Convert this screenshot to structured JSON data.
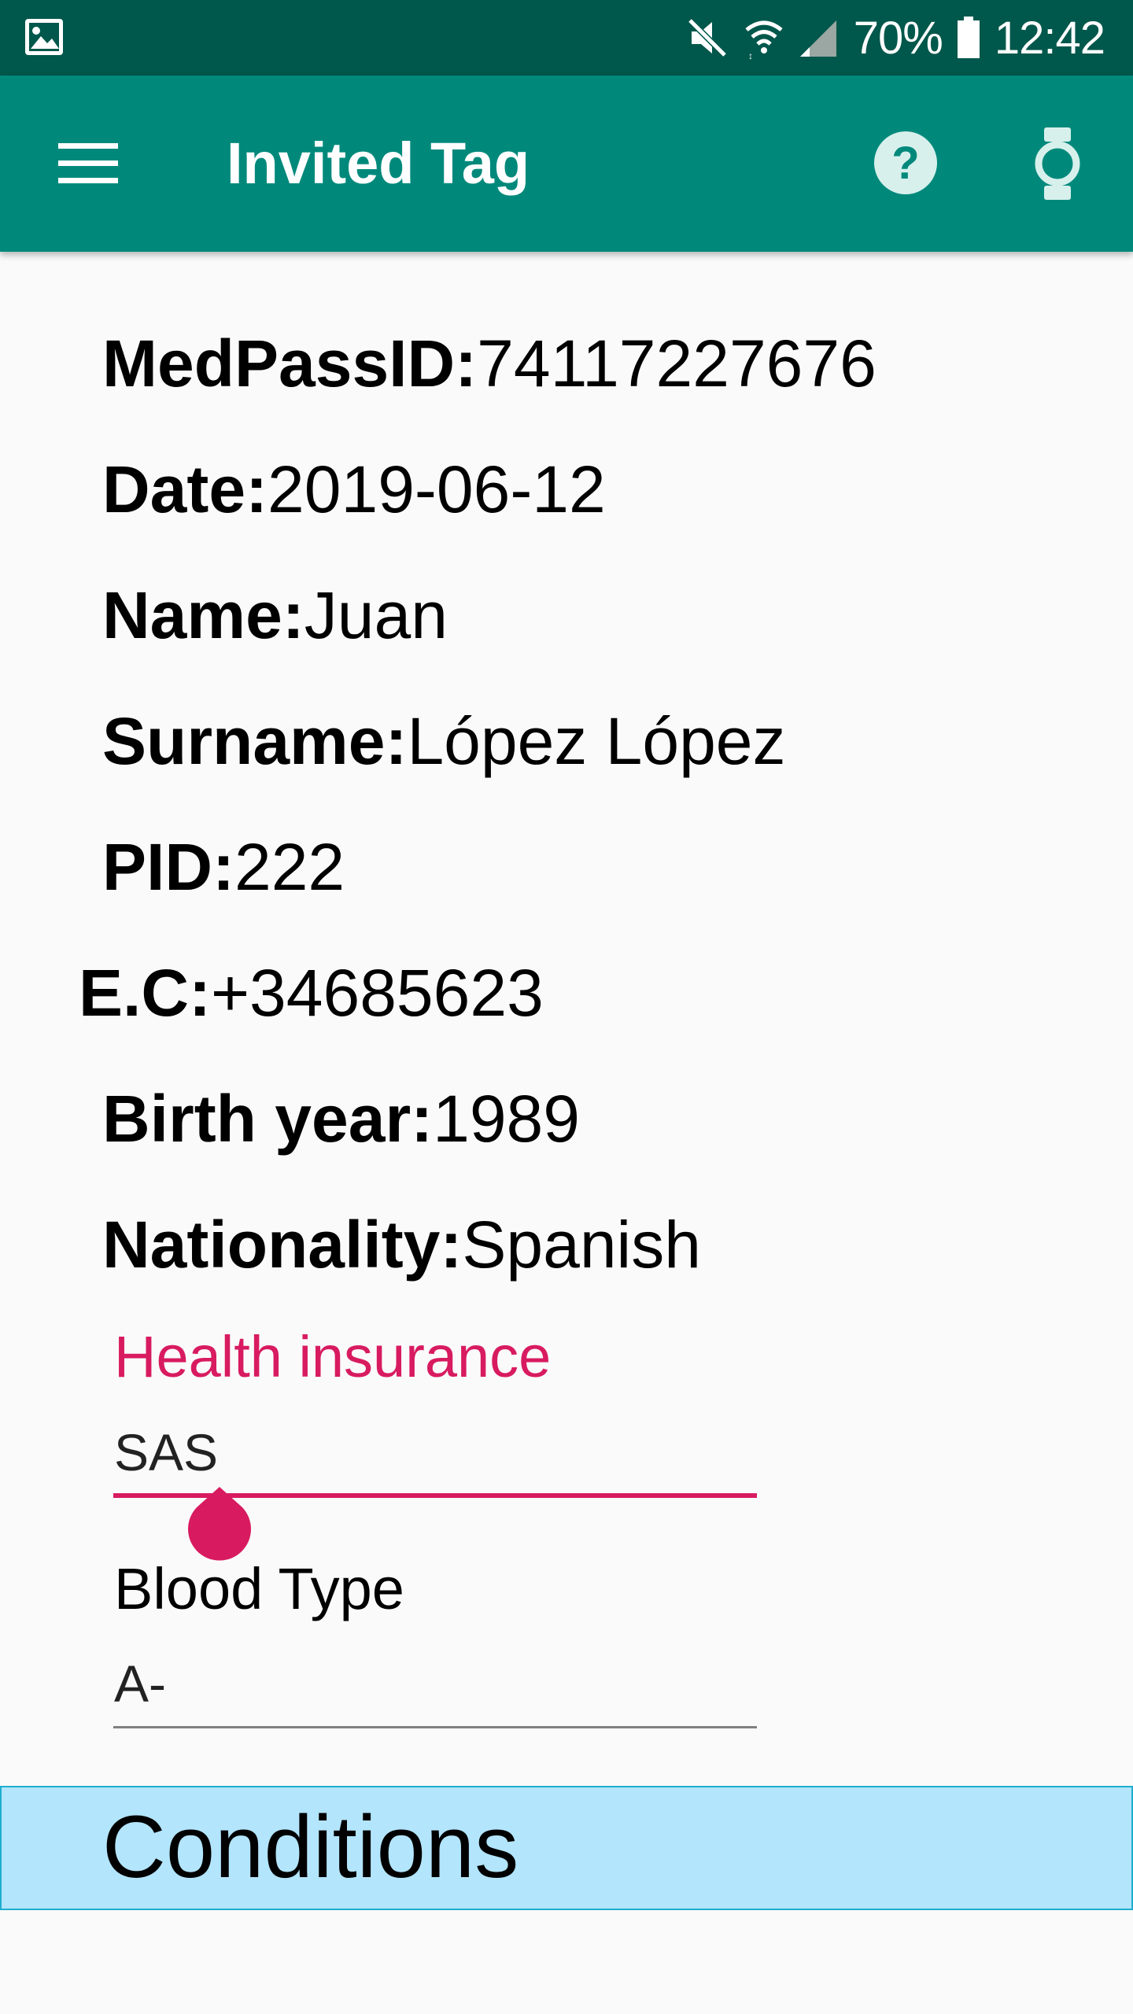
{
  "status_bar": {
    "battery_percent": "70%",
    "time": "12:42",
    "icons": [
      "image-icon",
      "mute-icon",
      "wifi-icon",
      "signal-icon",
      "battery-icon"
    ]
  },
  "app_bar": {
    "title": "Invited Tag",
    "icons": [
      "menu-icon",
      "help-icon",
      "watch-icon"
    ],
    "background_color": "#00897b",
    "status_color": "#00574b"
  },
  "info": {
    "medpass": {
      "label": "MedPassID:",
      "value": "74117227676"
    },
    "date": {
      "label": "Date:",
      "value": "2019-06-12"
    },
    "name": {
      "label": "Name:",
      "value": "Juan"
    },
    "surname": {
      "label": "Surname:",
      "value": "López López"
    },
    "pid": {
      "label": "PID:",
      "value": "222"
    },
    "ec": {
      "label": "E.C:",
      "value": "+34685623"
    },
    "birth_year": {
      "label": "Birth year:",
      "value": "1989"
    },
    "nationality": {
      "label": "Nationality:",
      "value": "Spanish"
    }
  },
  "fields": {
    "health_insurance": {
      "label": "Health insurance",
      "value": "SAS",
      "accent_color": "#d81b60"
    },
    "blood_type": {
      "label": "Blood Type",
      "value": "A-"
    }
  },
  "conditions": {
    "title": "Conditions",
    "color": "#b3e5fc"
  }
}
